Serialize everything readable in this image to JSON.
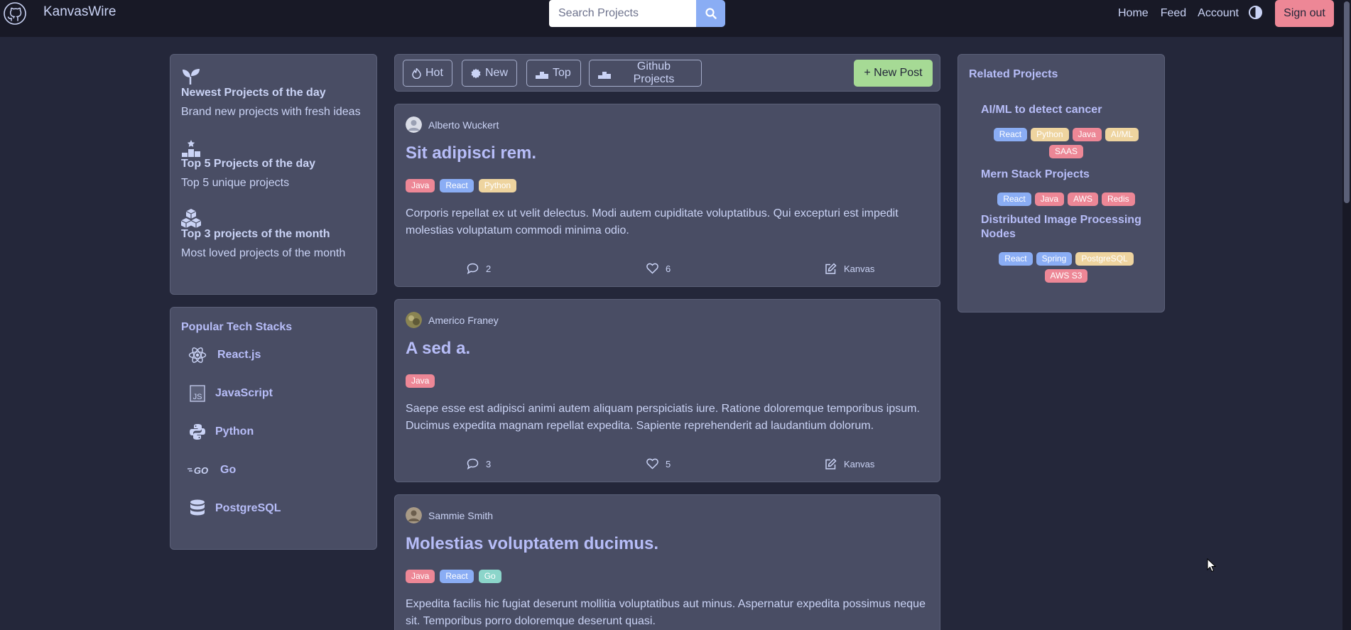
{
  "brand": {
    "name": "KanvasWire",
    "logo_icon": "github-icon"
  },
  "search": {
    "placeholder": "Search Projects",
    "value": "",
    "button_icon": "search-icon"
  },
  "nav": {
    "links": [
      "Home",
      "Feed",
      "Account"
    ],
    "theme_icon": "contrast-icon",
    "sign_out": "Sign out"
  },
  "highlights": [
    {
      "icon": "sprout-icon",
      "title": "Newest Projects of the day",
      "desc": "Brand new projects with fresh ideas"
    },
    {
      "icon": "podium-icon",
      "title": "Top 5 Projects of the day",
      "desc": "Top 5 unique projects"
    },
    {
      "icon": "cubes-icon",
      "title": "Top 3 projects of the month",
      "desc": "Most loved projects of the month"
    }
  ],
  "stacks": {
    "heading": "Popular Tech Stacks",
    "items": [
      {
        "label": "React.js",
        "icon": "react-icon"
      },
      {
        "label": "JavaScript",
        "icon": "javascript-icon"
      },
      {
        "label": "Python",
        "icon": "python-icon"
      },
      {
        "label": "Go",
        "icon": "go-icon"
      },
      {
        "label": "PostgreSQL",
        "icon": "database-icon"
      }
    ]
  },
  "filters": {
    "buttons": [
      {
        "label": "Hot",
        "icon": "fire-icon"
      },
      {
        "label": "New",
        "icon": "badge-icon"
      },
      {
        "label": "Top",
        "icon": "podium-icon"
      },
      {
        "label": "Github Projects",
        "icon": "podium-icon"
      }
    ],
    "new_post": "+ New Post"
  },
  "posts": [
    {
      "author": "Alberto Wuckert",
      "title": "Sit adipisci rem.",
      "tags": [
        "Java",
        "React",
        "Python"
      ],
      "body": "Corporis repellat ex ut velit delectus. Modi autem cupiditate voluptatibus. Qui excepturi est impedit molestias voluptatum commodi minima odio.",
      "comments": "2",
      "likes": "6",
      "edit_label": "Kanvas"
    },
    {
      "author": "Americo Franey",
      "title": "A sed a.",
      "tags": [
        "Java"
      ],
      "body": "Saepe esse est adipisci animi autem aliquam perspiciatis iure. Ratione doloremque temporibus ipsum. Ducimus expedita magnam repellat expedita. Sapiente reprehenderit ad laudantium dolorum.",
      "comments": "3",
      "likes": "5",
      "edit_label": "Kanvas"
    },
    {
      "author": "Sammie Smith",
      "title": "Molestias voluptatem ducimus.",
      "tags": [
        "Java",
        "React",
        "Go"
      ],
      "body": "Expedita facilis hic fugiat deserunt mollitia voluptatibus aut minus. Aspernatur expedita possimus neque sit. Temporibus porro doloremque deserunt quasi.",
      "comments": "",
      "likes": "",
      "edit_label": ""
    }
  ],
  "related": {
    "heading": "Related Projects",
    "projects": [
      {
        "title": "AI/ML to detect cancer",
        "tags": [
          "React",
          "Python",
          "Java",
          "AI/ML",
          "SAAS"
        ]
      },
      {
        "title": "Mern Stack Projects",
        "tags": [
          "React",
          "Java",
          "AWS",
          "Redis"
        ]
      },
      {
        "title": "Distributed Image Processing Nodes",
        "tags": [
          "React",
          "Spring",
          "PostgreSQL",
          "AWS S3"
        ]
      }
    ]
  },
  "colors": {
    "background": "#24273a",
    "navbar": "#181926",
    "panel": "#494d64",
    "accent": "#b7bdf8",
    "signout": "#ed8796",
    "new_post": "#a6da95",
    "search_button": "#8aadf4"
  }
}
